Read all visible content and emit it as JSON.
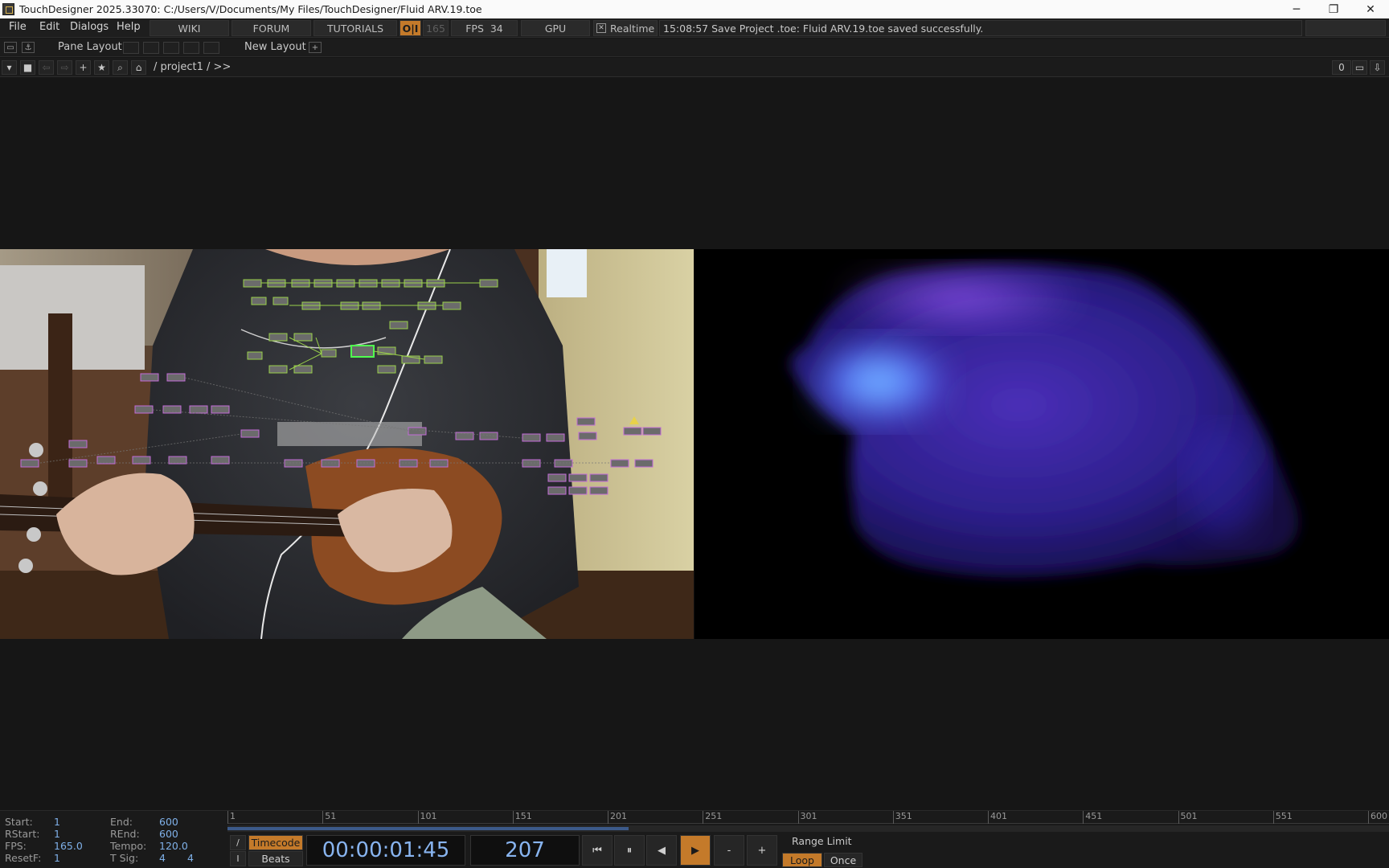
{
  "window": {
    "title": "TouchDesigner 2025.33070: C:/Users/V/Documents/My Files/TouchDesigner/Fluid ARV.19.toe",
    "minimize": "─",
    "restore": "❐",
    "close": "✕"
  },
  "menu": {
    "file": "File",
    "edit": "Edit",
    "dialogs": "Dialogs",
    "help": "Help",
    "wiki": "WIKI",
    "forum": "FORUM",
    "tutorials": "TUTORIALS",
    "oi": "O|I",
    "cook_rate": "165",
    "fps_label": "FPS",
    "fps_value": "34",
    "gpu": "GPU",
    "realtime_check": "✕",
    "realtime": "Realtime",
    "status_message": "15:08:57 Save Project .toe: Fluid ARV.19.toe saved successfully."
  },
  "pane": {
    "pane_layout": "Pane Layout",
    "new_layout": "New Layout",
    "add": "+"
  },
  "path": {
    "path_text": "/ project1 / >>",
    "counter": "0"
  },
  "timeline": {
    "start_label": "Start:",
    "start_value": "1",
    "end_label": "End:",
    "end_value": "600",
    "rstart_label": "RStart:",
    "rstart_value": "1",
    "rend_label": "REnd:",
    "rend_value": "600",
    "fps_label": "FPS:",
    "fps_value": "165.0",
    "tempo_label": "Tempo:",
    "tempo_value": "120.0",
    "resetf_label": "ResetF:",
    "resetf_value": "1",
    "tsig_label": "T Sig:",
    "tsig_a": "4",
    "tsig_b": "4",
    "ruler": [
      "1",
      "51",
      "101",
      "151",
      "201",
      "251",
      "301",
      "351",
      "401",
      "451",
      "501",
      "551",
      "600"
    ],
    "progress_fraction": 0.345,
    "timecode_label": "Timecode",
    "beats_label": "Beats",
    "timecode": "00:00:01:45",
    "frame": "207",
    "minus": "-",
    "plus": "+",
    "range_limit": "Range Limit",
    "loop": "Loop",
    "once": "Once"
  }
}
